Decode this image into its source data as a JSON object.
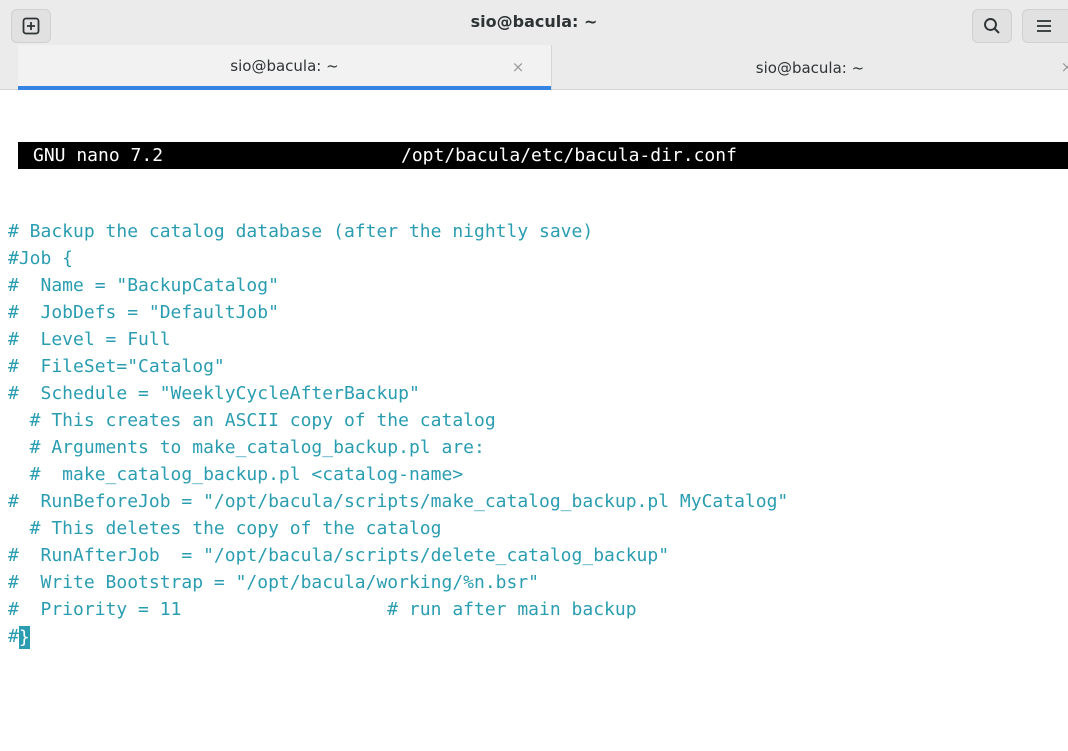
{
  "window": {
    "title": "sio@bacula: ~"
  },
  "header_buttons": {
    "new_tab_icon": "new-tab-icon",
    "search_icon": "search-icon",
    "menu_icon": "hamburger-menu-icon"
  },
  "tabs": [
    {
      "label": "sio@bacula: ~",
      "active": true,
      "close": "×"
    },
    {
      "label": "sio@bacula: ~",
      "active": false,
      "close": "×"
    }
  ],
  "editor": {
    "program": "GNU nano 7.2",
    "filename": "/opt/bacula/etc/bacula-dir.conf",
    "text_color": "#2a9db1",
    "lines": [
      "# Backup the catalog database (after the nightly save)",
      "#Job {",
      "#  Name = \"BackupCatalog\"",
      "#  JobDefs = \"DefaultJob\"",
      "#  Level = Full",
      "#  FileSet=\"Catalog\"",
      "#  Schedule = \"WeeklyCycleAfterBackup\"",
      "  # This creates an ASCII copy of the catalog",
      "  # Arguments to make_catalog_backup.pl are:",
      "  #  make_catalog_backup.pl <catalog-name>",
      "#  RunBeforeJob = \"/opt/bacula/scripts/make_catalog_backup.pl MyCatalog\"",
      "  # This deletes the copy of the catalog",
      "#  RunAfterJob  = \"/opt/bacula/scripts/delete_catalog_backup\"",
      "#  Write Bootstrap = \"/opt/bacula/working/%n.bsr\"",
      "#  Priority = 11                   # run after main backup"
    ],
    "last_line_prefix": "#",
    "cursor_char": "}"
  }
}
